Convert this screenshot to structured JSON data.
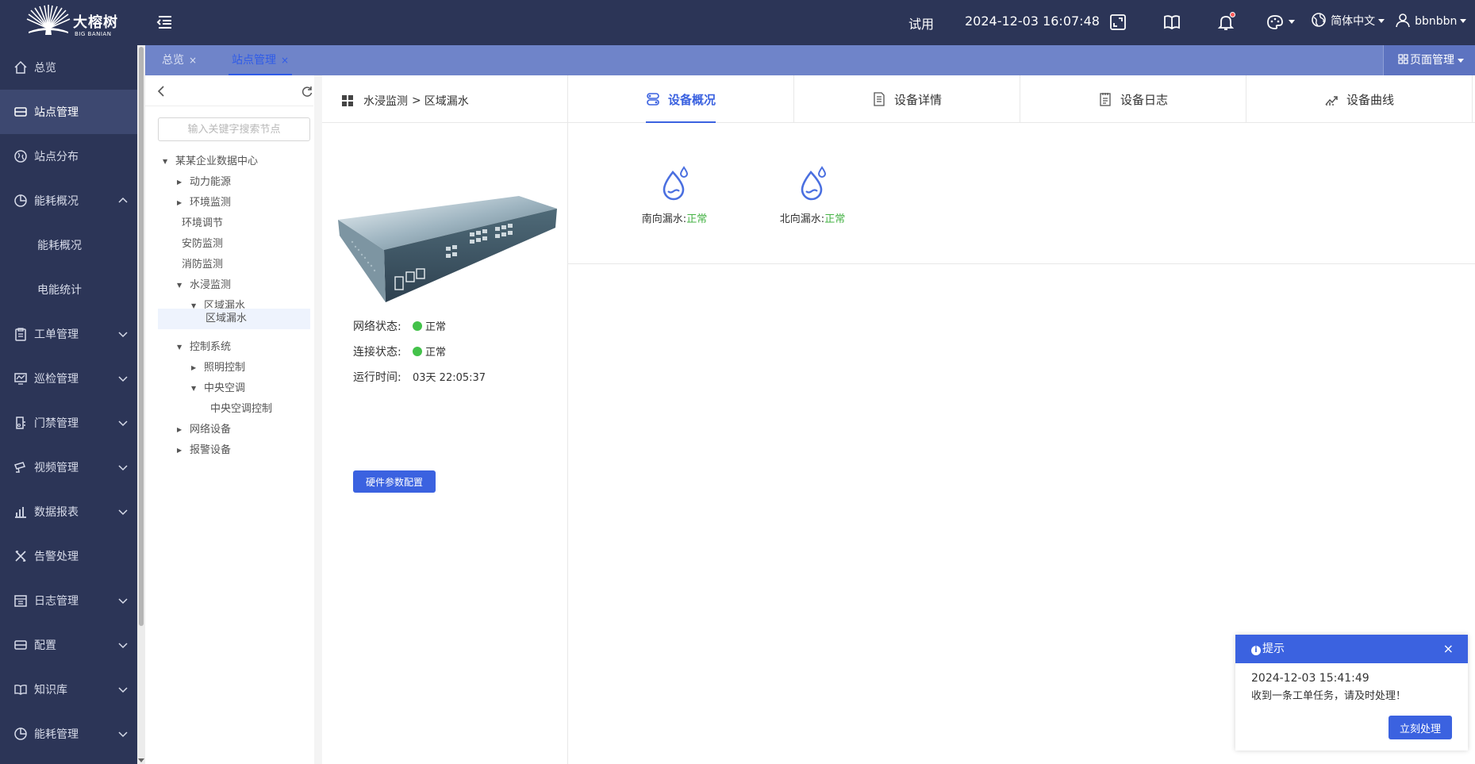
{
  "app": {
    "brand": "大榕树",
    "brand_en": "BIG BANIAN"
  },
  "header": {
    "trial": "试用",
    "datetime": "2024-12-03 16:07:48",
    "language": "简体中文",
    "user": "bbnbbn",
    "icons": [
      "menu-toggle-icon",
      "fullscreen-icon",
      "book-icon",
      "bell-icon",
      "palette-icon",
      "globe-icon",
      "user-icon"
    ]
  },
  "sidebar": {
    "items": [
      {
        "label": "总览",
        "icon": "home-icon"
      },
      {
        "label": "站点管理",
        "icon": "storage-icon"
      },
      {
        "label": "站点分布",
        "icon": "map-pin-icon"
      },
      {
        "label": "能耗概况",
        "icon": "pie-chart-icon"
      },
      {
        "label": "能耗概况",
        "icon": ""
      },
      {
        "label": "电能统计",
        "icon": ""
      },
      {
        "label": "工单管理",
        "icon": "clipboard-icon"
      },
      {
        "label": "巡检管理",
        "icon": "monitor-icon"
      },
      {
        "label": "门禁管理",
        "icon": "door-icon"
      },
      {
        "label": "视频管理",
        "icon": "camera-icon"
      },
      {
        "label": "数据报表",
        "icon": "bar-chart-icon"
      },
      {
        "label": "告警处理",
        "icon": "tools-icon"
      },
      {
        "label": "日志管理",
        "icon": "calendar-icon"
      },
      {
        "label": "配置",
        "icon": "server-icon"
      },
      {
        "label": "知识库",
        "icon": "open-book-icon"
      },
      {
        "label": "能耗管理",
        "icon": "pie-chart-icon"
      }
    ]
  },
  "tabs": {
    "items": [
      {
        "label": "总览",
        "close": "×"
      },
      {
        "label": "站点管理",
        "close": "×"
      }
    ],
    "page_manage": "页面管理"
  },
  "tree": {
    "search_placeholder": "输入关键字搜索节点",
    "nodes": [
      {
        "label": "某某企业数据中心",
        "arrow": "▼"
      },
      {
        "label": "动力能源",
        "arrow": "▶"
      },
      {
        "label": "环境监测",
        "arrow": "▶"
      },
      {
        "label": "环境调节",
        "arrow": ""
      },
      {
        "label": "安防监测",
        "arrow": ""
      },
      {
        "label": "消防监测",
        "arrow": ""
      },
      {
        "label": "水浸监测",
        "arrow": "▼"
      },
      {
        "label": "区域漏水",
        "arrow": "▼"
      },
      {
        "label": "区域漏水",
        "arrow": ""
      },
      {
        "label": "控制系统",
        "arrow": "▼"
      },
      {
        "label": "照明控制",
        "arrow": "▶"
      },
      {
        "label": "中央空调",
        "arrow": "▼"
      },
      {
        "label": "中央空调控制",
        "arrow": ""
      },
      {
        "label": "网络设备",
        "arrow": "▶"
      },
      {
        "label": "报警设备",
        "arrow": "▶"
      }
    ]
  },
  "main": {
    "breadcrumb": {
      "parent": "水浸监测",
      "sep": ">",
      "current": "区域漏水"
    },
    "device_tabs": [
      {
        "label": "设备概况",
        "icon": "toggle-stack-icon"
      },
      {
        "label": "设备详情",
        "icon": "document-icon"
      },
      {
        "label": "设备日志",
        "icon": "notepad-icon"
      },
      {
        "label": "设备曲线",
        "icon": "trend-icon"
      }
    ],
    "status": [
      {
        "label": "网络状态:",
        "value": "正常"
      },
      {
        "label": "连接状态:",
        "value": "正常"
      },
      {
        "label": "运行时间:",
        "value": "03天 22:05:37"
      }
    ],
    "hw_button": "硬件参数配置",
    "sensors": [
      {
        "label": "南向漏水:",
        "value": "正常"
      },
      {
        "label": "北向漏水:",
        "value": "正常"
      }
    ]
  },
  "notification": {
    "title": "提示",
    "info_glyph": "i",
    "close": "×",
    "time": "2024-12-03 15:41:49",
    "message": "收到一条工单任务，请及时处理！",
    "button": "立刻处理"
  },
  "colors": {
    "nav_bg": "#2c3557",
    "tab_strip": "#6f84c9",
    "primary": "#3b62e0",
    "ok_green": "#43c24a"
  }
}
